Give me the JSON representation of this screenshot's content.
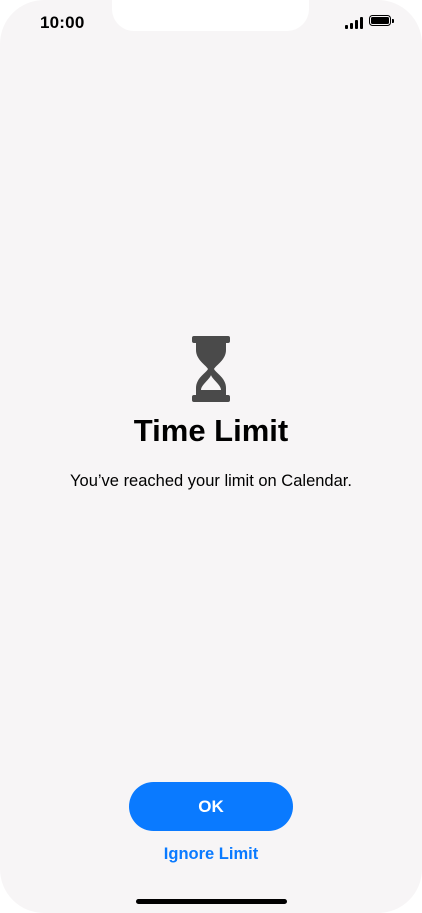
{
  "status_bar": {
    "time": "10:00",
    "signal_icon": "cellular-signal-icon",
    "battery_icon": "battery-icon"
  },
  "alert": {
    "icon": "hourglass-icon",
    "title": "Time Limit",
    "message": "You’ve reached your limit on Calendar."
  },
  "actions": {
    "ok_label": "OK",
    "ignore_label": "Ignore Limit"
  },
  "colors": {
    "accent": "#0a7aff",
    "background": "#f7f5f6",
    "icon": "#4a4a4a"
  }
}
